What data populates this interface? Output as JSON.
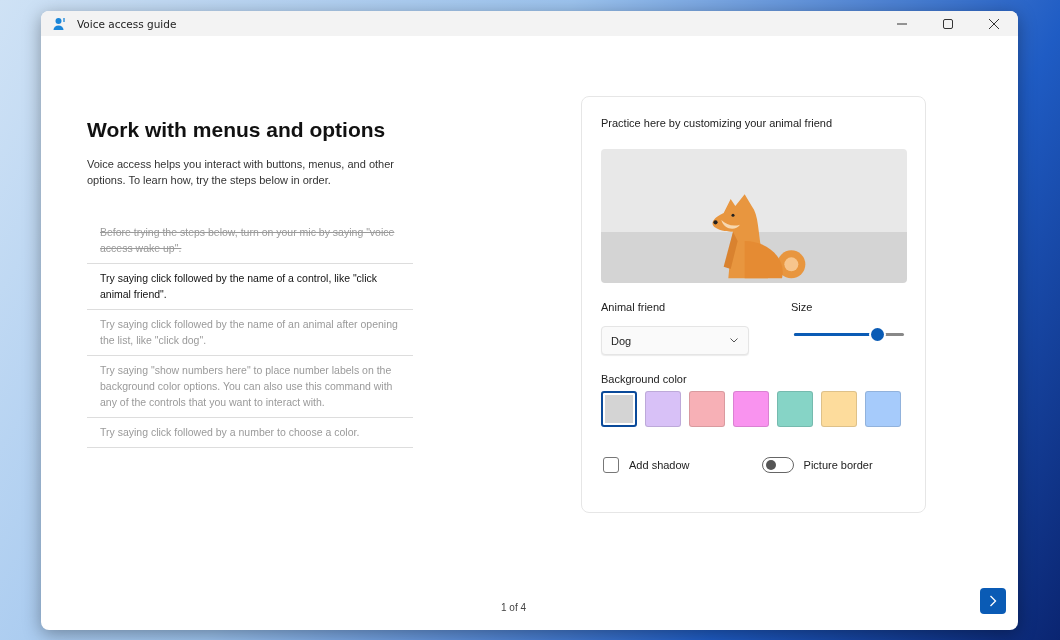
{
  "window": {
    "title": "Voice access guide"
  },
  "lesson": {
    "title": "Work with menus and options",
    "intro": "Voice access helps you interact with buttons, menus, and other options. To learn how, try the steps below in order.",
    "steps": [
      {
        "text": "Before trying the steps below, turn on your mic by saying \"voice access wake up\".",
        "completed": true,
        "selected": false
      },
      {
        "text": "Try saying click followed by the name of a control, like \"click animal friend\".",
        "completed": false,
        "selected": true
      },
      {
        "text": "Try saying click followed by the name of an animal after opening the list, like \"click dog\".",
        "completed": false,
        "selected": false
      },
      {
        "text": "Try saying \"show numbers here\" to place number labels on the background color options. You can also use this command with any of the controls that you want to interact with.",
        "completed": false,
        "selected": false
      },
      {
        "text": "Try saying click followed by a number to choose a color.",
        "completed": false,
        "selected": false
      }
    ]
  },
  "practice": {
    "title": "Practice here by customizing your animal friend",
    "animal_label": "Animal friend",
    "animal_value": "Dog",
    "size_label": "Size",
    "size": {
      "level": 0.75
    },
    "background_label": "Background color",
    "swatches": [
      {
        "color": "#d4d4d4",
        "selected": true
      },
      {
        "color": "#d8c1f7",
        "selected": false
      },
      {
        "color": "#f7b0b6",
        "selected": false
      },
      {
        "color": "#f993ef",
        "selected": false
      },
      {
        "color": "#86d4c6",
        "selected": false
      },
      {
        "color": "#fddc9c",
        "selected": false
      },
      {
        "color": "#a6cbfb",
        "selected": false
      }
    ],
    "shadow": {
      "label": "Add shadow",
      "checked": false
    },
    "border": {
      "label": "Picture border",
      "on": false
    }
  },
  "footer": {
    "page": "1 of 4"
  }
}
